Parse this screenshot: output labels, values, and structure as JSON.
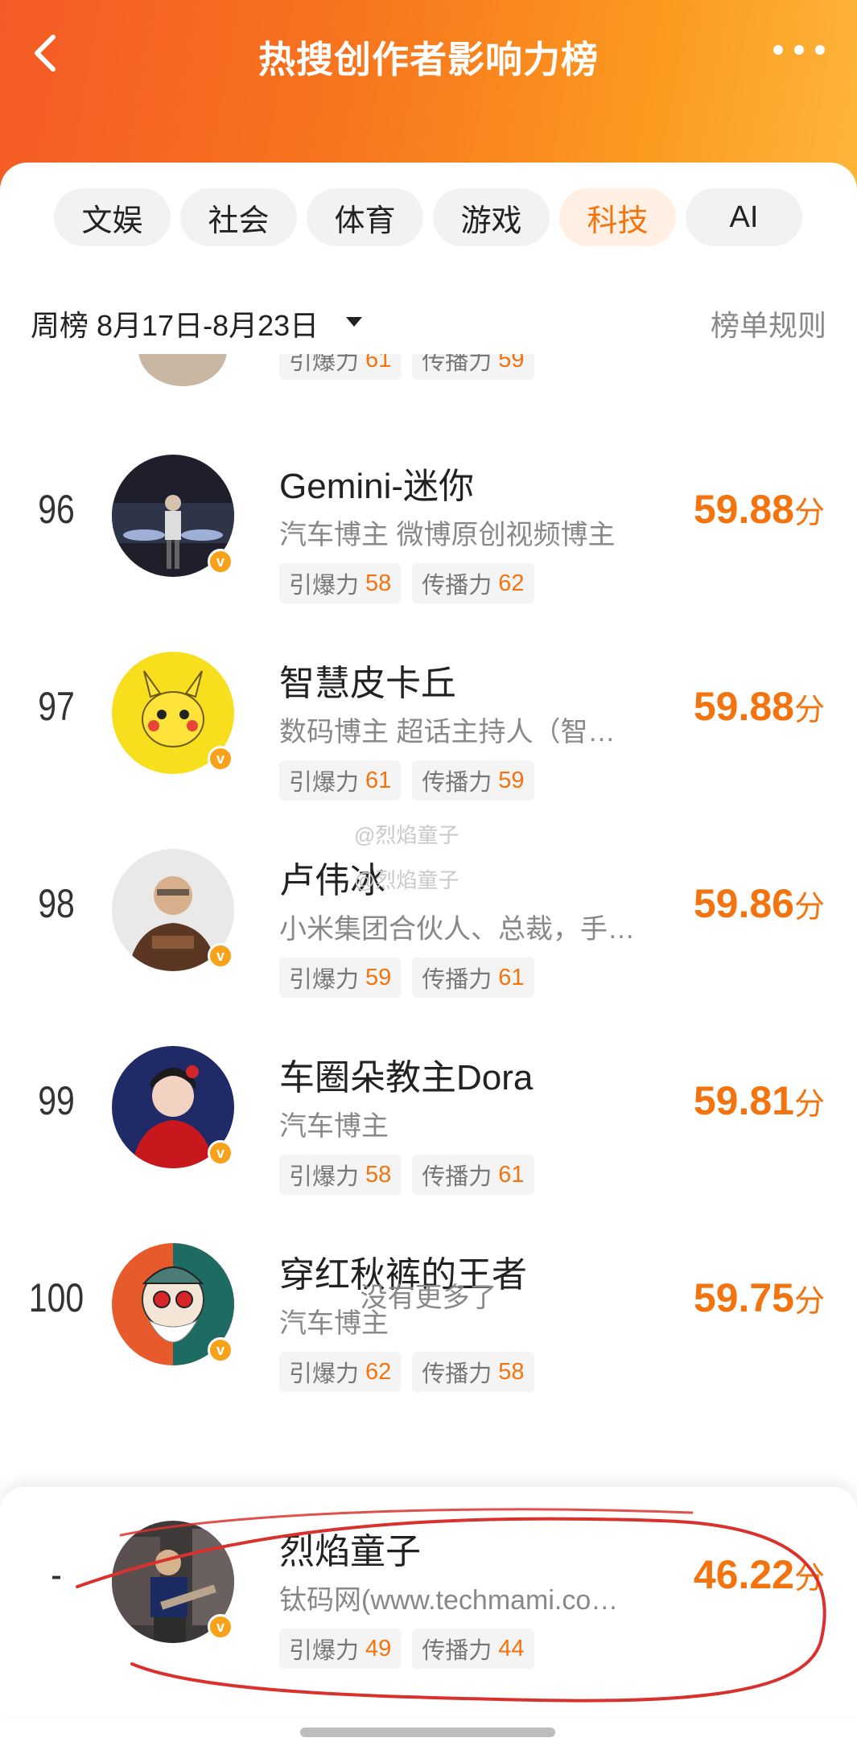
{
  "header": {
    "title": "热搜创作者影响力榜"
  },
  "tabs": [
    {
      "label": "文娱"
    },
    {
      "label": "社会"
    },
    {
      "label": "体育"
    },
    {
      "label": "游戏"
    },
    {
      "label": "科技"
    },
    {
      "label": "AI"
    }
  ],
  "filter": {
    "week_label": "周榜 8月17日-8月23日",
    "rules_label": "榜单规则"
  },
  "partial_row": {
    "chips": [
      {
        "label": "引爆力",
        "value": "61"
      },
      {
        "label": "传播力",
        "value": "59"
      }
    ]
  },
  "rows": [
    {
      "rank": "96",
      "name": "Gemini-迷你",
      "desc": "汽车博主 微博原创视频博主",
      "chips": [
        {
          "label": "引爆力",
          "value": "58"
        },
        {
          "label": "传播力",
          "value": "62"
        }
      ],
      "score": "59.88",
      "unit": "分"
    },
    {
      "rank": "97",
      "name": "智慧皮卡丘",
      "desc": "数码博主 超话主持人（智…",
      "chips": [
        {
          "label": "引爆力",
          "value": "61"
        },
        {
          "label": "传播力",
          "value": "59"
        }
      ],
      "score": "59.88",
      "unit": "分"
    },
    {
      "rank": "98",
      "name": "卢伟冰",
      "desc": "小米集团合伙人、总裁，手…",
      "chips": [
        {
          "label": "引爆力",
          "value": "59"
        },
        {
          "label": "传播力",
          "value": "61"
        }
      ],
      "score": "59.86",
      "unit": "分"
    },
    {
      "rank": "99",
      "name": "车圈朵教主Dora",
      "desc": "汽车博主",
      "chips": [
        {
          "label": "引爆力",
          "value": "58"
        },
        {
          "label": "传播力",
          "value": "61"
        }
      ],
      "score": "59.81",
      "unit": "分"
    },
    {
      "rank": "100",
      "name": "穿红秋裤的王者",
      "desc": "汽车博主",
      "chips": [
        {
          "label": "引爆力",
          "value": "62"
        },
        {
          "label": "传播力",
          "value": "58"
        }
      ],
      "score": "59.75",
      "unit": "分"
    }
  ],
  "no_more_text": "没有更多了",
  "self": {
    "rank": "-",
    "name": "烈焰童子",
    "desc": "钛码网(www.techmami.co…",
    "chips": [
      {
        "label": "引爆力",
        "value": "49"
      },
      {
        "label": "传播力",
        "value": "44"
      }
    ],
    "score": "46.22",
    "unit": "分"
  },
  "watermark": [
    "@烈焰童子",
    "@烈焰童子"
  ],
  "badge_letter": "v",
  "colors": {
    "accent": "#f3740f",
    "header_start": "#f45a25",
    "header_end": "#fdb63a",
    "annotation": "#d9322e"
  }
}
